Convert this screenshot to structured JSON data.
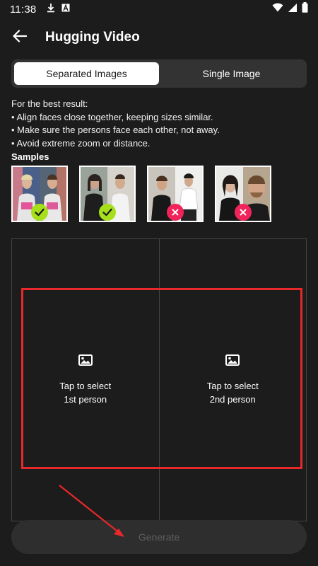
{
  "status_bar": {
    "time": "11:38",
    "icons": [
      "download-icon",
      "font-a-icon",
      "wifi-icon",
      "signal-icon",
      "battery-icon"
    ]
  },
  "app_bar": {
    "back_icon": "arrow-left-icon",
    "title": "Hugging Video"
  },
  "tabs": [
    {
      "label": "Separated Images",
      "active": true
    },
    {
      "label": "Single Image",
      "active": false
    }
  ],
  "tips": {
    "intro": "For the best result:",
    "items": [
      "• Align faces close together, keeping sizes similar.",
      "• Make sure the persons face each other, not away.",
      "• Avoid extreme zoom or distance."
    ]
  },
  "samples": {
    "title": "Samples",
    "items": [
      {
        "status": "good",
        "icon": "check-icon"
      },
      {
        "status": "good",
        "icon": "check-icon"
      },
      {
        "status": "bad",
        "icon": "close-icon"
      },
      {
        "status": "bad",
        "icon": "close-icon"
      }
    ]
  },
  "upload": {
    "first": {
      "line1": "Tap to select",
      "line2": "1st person",
      "icon": "image-icon"
    },
    "second": {
      "line1": "Tap to select",
      "line2": "2nd person",
      "icon": "image-icon"
    }
  },
  "generate_label": "Generate",
  "colors": {
    "background": "#1c1c1c",
    "good_badge": "#a6e01a",
    "bad_badge": "#f0245a",
    "annotation": "#e8282a"
  }
}
